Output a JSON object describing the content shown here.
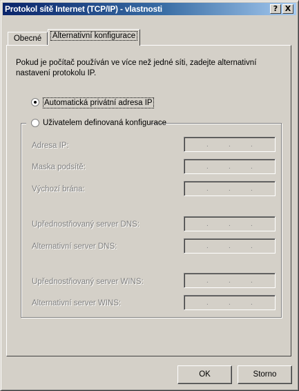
{
  "window": {
    "title": "Protokol sítě Internet (TCP/IP) - vlastnosti",
    "help_label": "?",
    "close_label": "X"
  },
  "tabs": [
    {
      "label": "Obecné",
      "active": false
    },
    {
      "label": "Alternativní konfigurace",
      "active": true
    }
  ],
  "description": "Pokud je počítač používán ve více než jedné síti, zadejte alternativní nastavení protokolu IP.",
  "options": {
    "automatic": {
      "label": "Automatická privátní adresa IP",
      "checked": true
    },
    "user_defined": {
      "label": "Uživatelem definovaná konfigurace",
      "checked": false
    }
  },
  "fields": [
    {
      "label": "Adresa IP:",
      "value": ""
    },
    {
      "label": "Maska podsítě:",
      "value": ""
    },
    {
      "label": "Výchozí brána:",
      "value": ""
    },
    {
      "label": "Upřednostňovaný server DNS:",
      "value": ""
    },
    {
      "label": "Alternativní server DNS:",
      "value": ""
    },
    {
      "label": "Upřednostňovaný server WINS:",
      "value": ""
    },
    {
      "label": "Alternativní server WINS:",
      "value": ""
    }
  ],
  "buttons": {
    "ok": "OK",
    "cancel": "Storno"
  },
  "colors": {
    "title_bar": "#0a246a",
    "face": "#d4d0c8",
    "disabled_text": "#808080"
  }
}
